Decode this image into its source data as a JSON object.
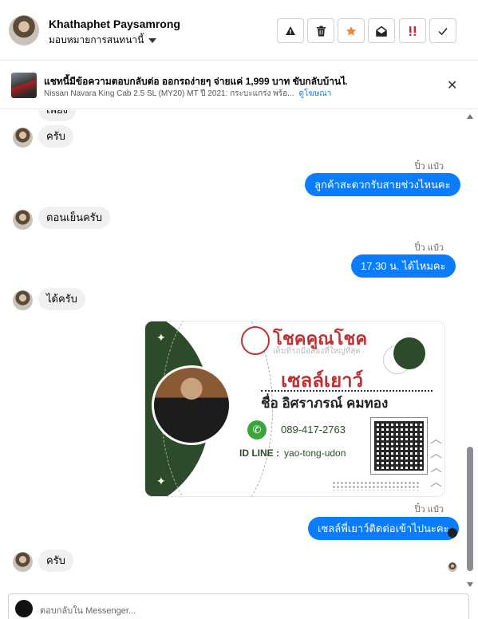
{
  "header": {
    "contact_name": "Khathaphet Paysamrong",
    "assign_label": "มอบหมายการสนทนานี้",
    "buttons": [
      {
        "name": "report-button",
        "glyph": "⚠"
      },
      {
        "name": "delete-button",
        "glyph": "🗑"
      },
      {
        "name": "star-button",
        "glyph": "★"
      },
      {
        "name": "mark-unread-button",
        "glyph": "✉"
      },
      {
        "name": "important-button",
        "glyph": "!!"
      },
      {
        "name": "done-button",
        "glyph": "✓"
      }
    ]
  },
  "context": {
    "title": "แชทนี้มีข้อความตอบกลับต่อ ออกรถง่ายๆ จ่ายแค่ 1,999 บาท ขับกลับบ้านไ...",
    "subtitle": "Nissan Navara King Cab 2.5 SL (MY20) MT ปี 2021: กระบะแกร่ง พร้อ...",
    "link": "ดูโฆษณา",
    "close_glyph": "✕"
  },
  "messages": {
    "partial_top": "เพียง",
    "m1": "ครับ",
    "m2_sender": "ปิ๋ว แป๋ว",
    "m2": "ลูกค้าสะดวกรับสายช่วงไหนคะ",
    "m3": "ตอนเย็นครับ",
    "m4_sender": "ปิ๋ว แป๋ว",
    "m4": "17.30 น. ได้ไหมคะ",
    "m5": "ได้ครับ",
    "m7_sender": "ปิ๋ว แป๋ว",
    "m7": "เซลล์พี่เยาว์ติดต่อเข้าไปนะคะ",
    "m8": "ครับ"
  },
  "card": {
    "brand": "โชคคูณโชค",
    "slogan": "เต็มที่รถมือสองที่ใหญ่ที่สุด",
    "role": "เซลล์เยาว์",
    "name": "ชื่อ อิศราภรณ์  คมทอง",
    "phone": "089-417-2763",
    "line_label": "ID LINE :",
    "line_id": "yao-tong-udon"
  },
  "composer": {
    "placeholder": "ตอบกลับใน Messenger..."
  },
  "colors": {
    "accent": "#0a7cff",
    "incoming_bubble": "#f0f0f0",
    "card_green": "#2d4a2a",
    "card_red": "#c03030"
  }
}
